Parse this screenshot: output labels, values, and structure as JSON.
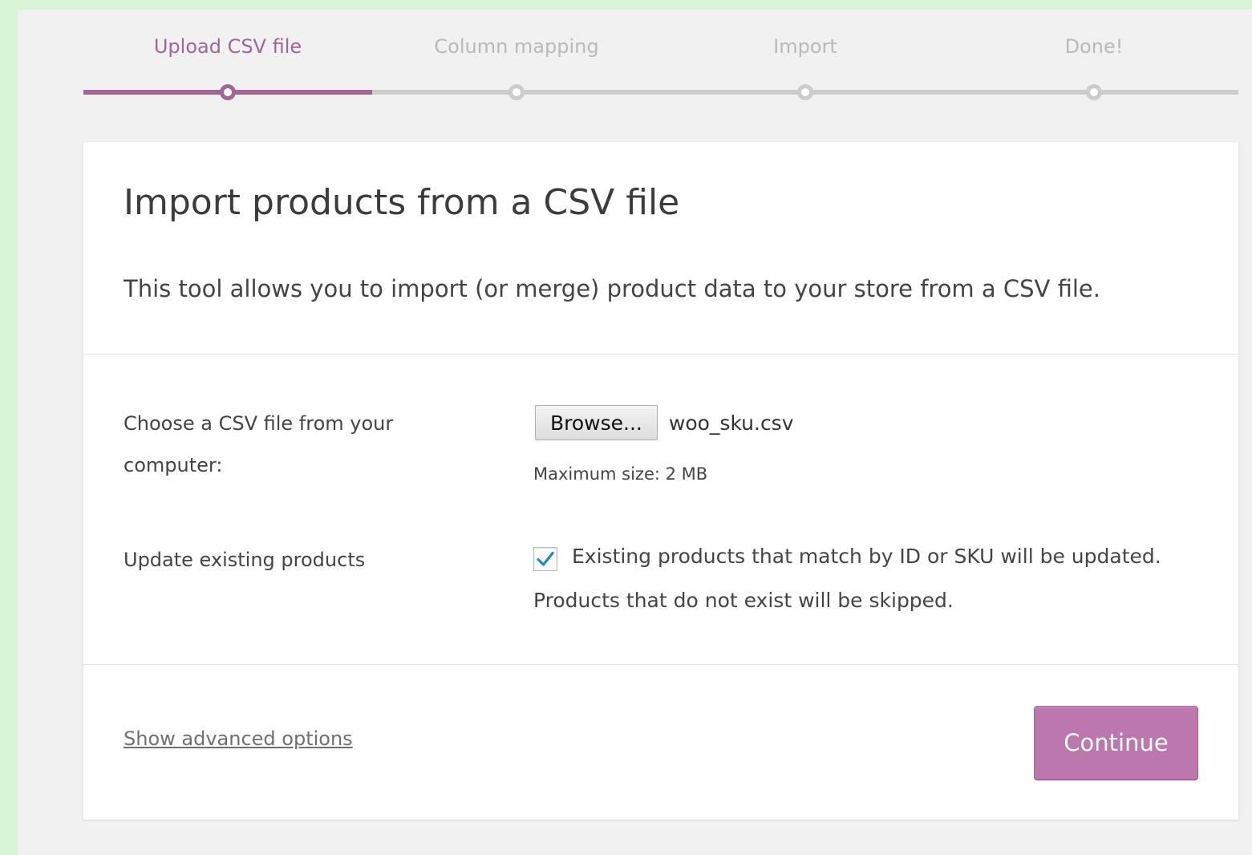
{
  "steps": [
    {
      "label": "Upload CSV file",
      "active": true
    },
    {
      "label": "Column mapping",
      "active": false
    },
    {
      "label": "Import",
      "active": false
    },
    {
      "label": "Done!",
      "active": false
    }
  ],
  "card": {
    "title": "Import products from a CSV file",
    "description": "This tool allows you to import (or merge) product data to your store from a CSV file."
  },
  "file_upload": {
    "label": "Choose a CSV file from your computer:",
    "browse_label": "Browse...",
    "file_name": "woo_sku.csv",
    "max_size": "Maximum size: 2 MB"
  },
  "update_existing": {
    "label": "Update existing products",
    "checked": true,
    "description_line1": "Existing products that match by ID or SKU will be updated.",
    "description_line2": "Products that do not exist will be skipped."
  },
  "footer": {
    "advanced_link": "Show advanced options",
    "continue_label": "Continue"
  },
  "colors": {
    "accent": "#a16696",
    "button": "#bb77ae",
    "check": "#1e8cbe",
    "inactive_step": "#cccccc"
  }
}
